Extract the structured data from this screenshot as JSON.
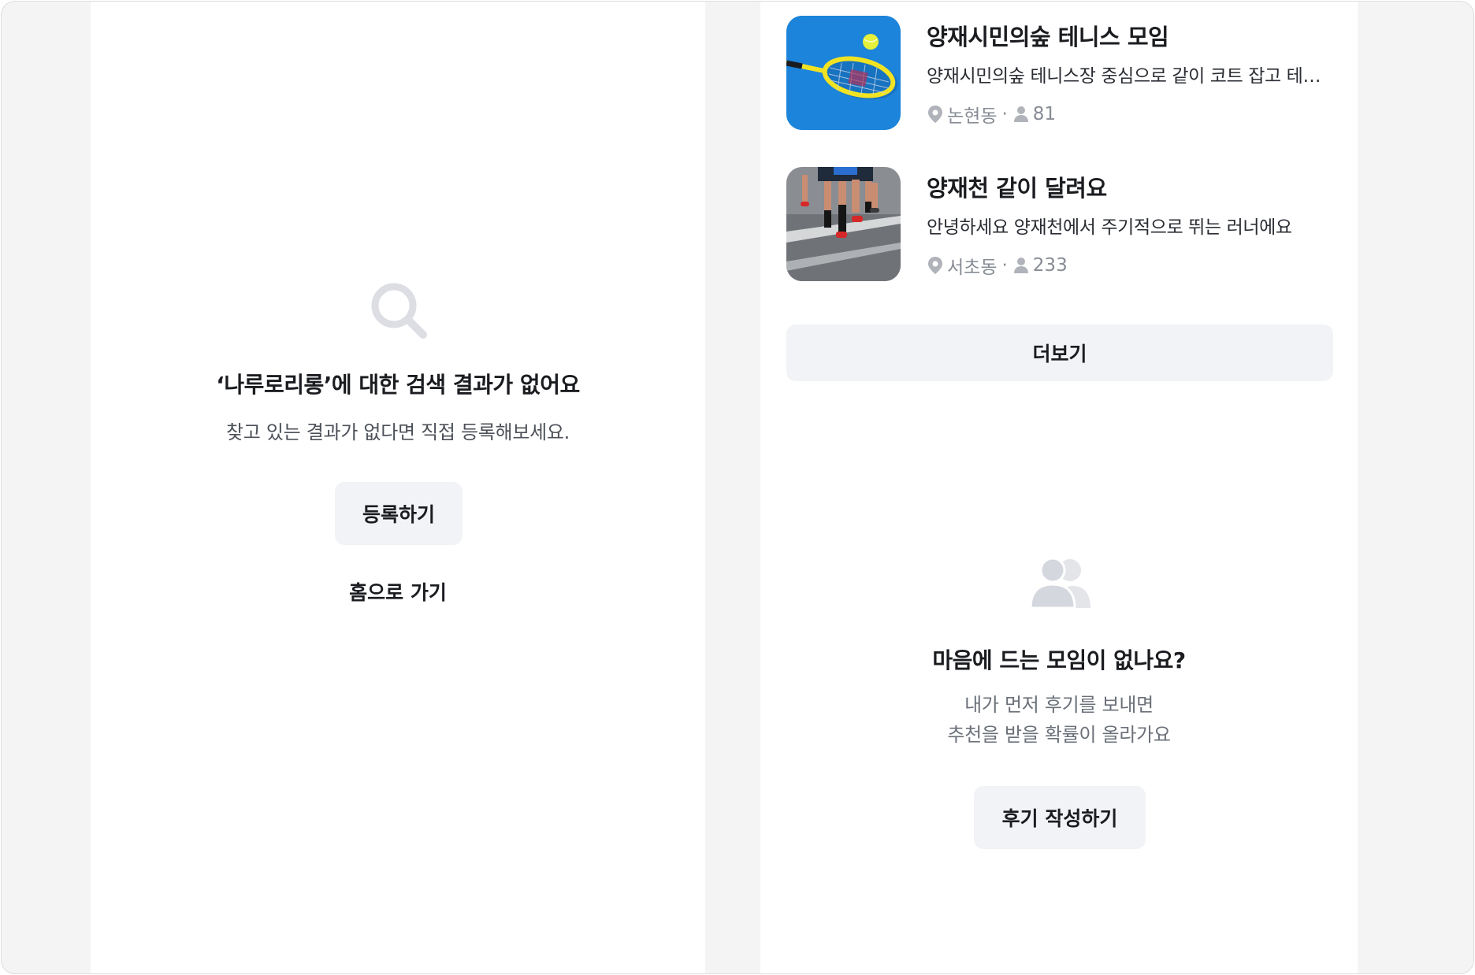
{
  "search_empty": {
    "icon": "search-icon",
    "title": "‘나루로리롱’에 대한 검색 결과가 없어요",
    "subtitle": "찾고 있는 결과가 없다면 직접 등록해보세요.",
    "register_label": "등록하기",
    "home_label": "홈으로 가기"
  },
  "groups": [
    {
      "name": "양재시민의숲 테니스 모임",
      "description": "양재시민의숲 테니스장 중심으로 같이 코트 잡고 테니스 쳐요",
      "location": "논현동",
      "members": "81",
      "thumbnail": "tennis-racket-image"
    },
    {
      "name": "양재천 같이 달려요",
      "description": "안녕하세요 양재천에서 주기적으로 뛰는 러너에요",
      "location": "서초동",
      "members": "233",
      "thumbnail": "runners-image"
    }
  ],
  "more_label": "더보기",
  "review_cta": {
    "icon": "people-icon",
    "title": "마음에 드는 모임이 없나요?",
    "line1": "내가 먼저 후기를 보내면",
    "line2": "추천을 받을 확률이 올라가요",
    "button_label": "후기 작성하기"
  },
  "colors": {
    "background": "#f4f4f5",
    "button_bg": "#f2f3f6",
    "muted_text": "#868b94",
    "icon_gray": "#dcdee3",
    "tennis_blue": "#1a7fd4",
    "racket_yellow": "#f2e322"
  }
}
